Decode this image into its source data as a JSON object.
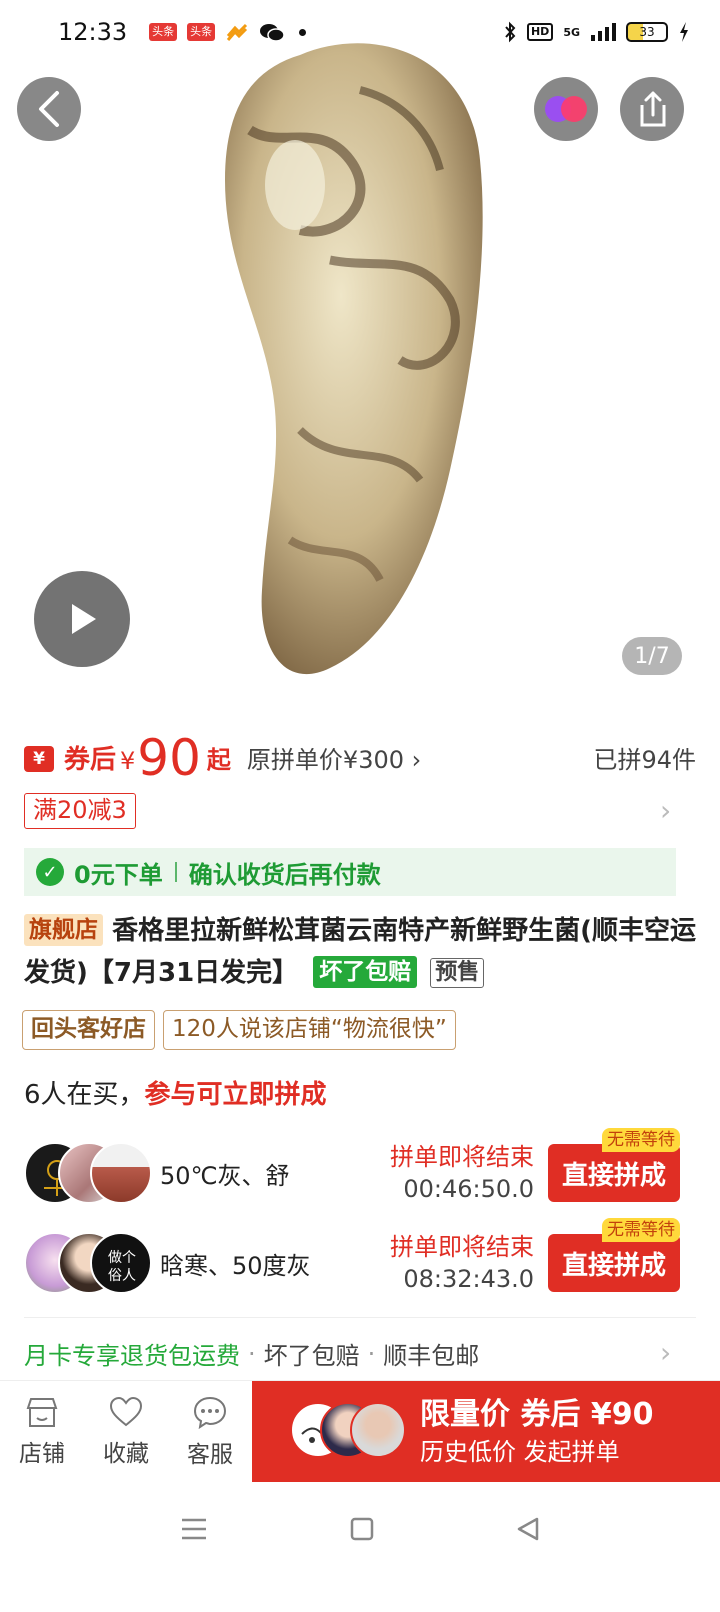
{
  "status_bar": {
    "time": "12:33",
    "apps": [
      "头条",
      "头条"
    ],
    "network": "5G",
    "hd": "HD",
    "battery": "33"
  },
  "gallery": {
    "page_indicator": "1/7"
  },
  "price": {
    "coupon_label": "券后",
    "currency": "¥",
    "amount": "90",
    "from_suffix": "起",
    "original": "原拼单价¥300 ›",
    "sold": "已拼94件"
  },
  "discount_tag": "满20减3",
  "guarantee": {
    "part1": "0元下单",
    "part2": "确认收货后再付款"
  },
  "title": {
    "store_badge": "旗舰店",
    "text": "香格里拉新鲜松茸菌云南特产新鲜野生菌(顺丰空运发货)【7月31日发完】",
    "badge_green": "坏了包赔",
    "badge_presale": "预售"
  },
  "shop_tags": [
    "回头客好店",
    "120人说该店铺“物流很快”"
  ],
  "buying": {
    "count_text": "6人在买，",
    "cta_text": "参与可立即拼成"
  },
  "groups": [
    {
      "name": "50℃灰、舒",
      "status": "拼单即将结束",
      "countdown": "00:46:50.0",
      "button": "直接拼成",
      "badge": "无需等待"
    },
    {
      "name": "晗寒、50度灰",
      "status": "拼单即将结束",
      "countdown": "08:32:43.0",
      "button": "直接拼成",
      "badge": "无需等待"
    }
  ],
  "services": {
    "highlight": "月卡专享退货包运费",
    "items": [
      "坏了包赔",
      "顺丰包邮"
    ]
  },
  "bottom_bar": {
    "store": "店铺",
    "favorite": "收藏",
    "service": "客服",
    "cta_main": "限量价 券后 ¥90",
    "cta_sub": "历史低价 发起拼单"
  },
  "colors": {
    "brand_red": "#e02e24",
    "green": "#25a93a"
  }
}
